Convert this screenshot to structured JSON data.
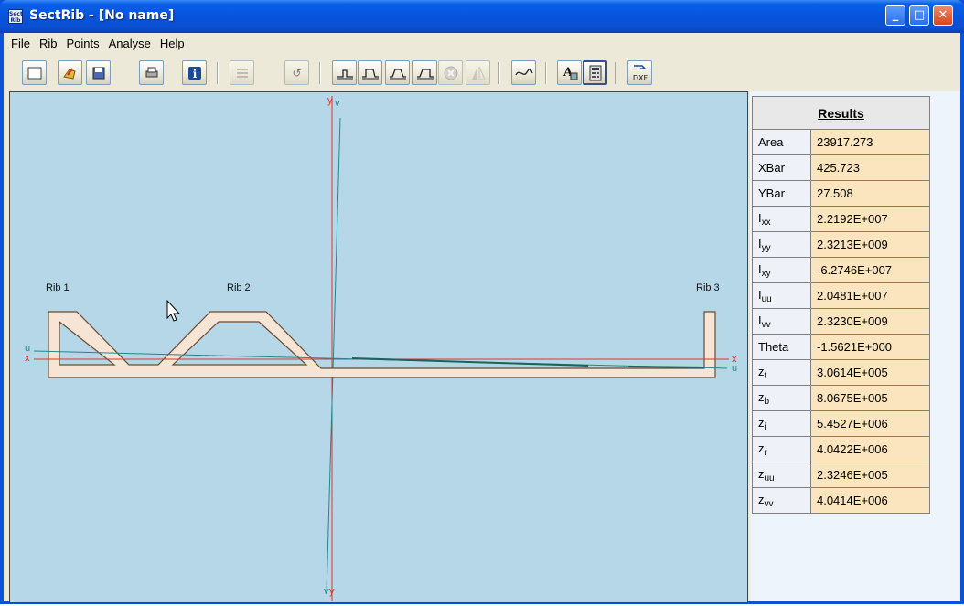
{
  "window": {
    "title": "SectRib - [No name]",
    "app_icon_text": "Sect Rib"
  },
  "menu": [
    "File",
    "Rib",
    "Points",
    "Analyse",
    "Help"
  ],
  "toolbar": {
    "buttons": [
      "new-icon",
      "open-icon",
      "save-icon",
      "print-icon",
      "info-icon",
      "list-icon",
      "undo-icon",
      "rib-shape-1-icon",
      "rib-shape-2-icon",
      "rib-shape-3-icon",
      "rib-shape-4-icon",
      "delete-rib-icon",
      "mirror-icon",
      "curve-icon",
      "text-font-icon",
      "calculator-icon",
      "dxf-export-icon"
    ],
    "dxf_label": "DXF"
  },
  "drawing": {
    "ribs": [
      "Rib 1",
      "Rib 2",
      "Rib 3"
    ],
    "axis_labels": {
      "y": "y",
      "v": "v",
      "x": "x",
      "u": "u"
    }
  },
  "results": {
    "title": "Results",
    "rows": [
      {
        "name": "Area",
        "sub": "",
        "value": "23917.273"
      },
      {
        "name": "XBar",
        "sub": "",
        "value": "425.723"
      },
      {
        "name": "YBar",
        "sub": "",
        "value": "27.508"
      },
      {
        "name": "I",
        "sub": "xx",
        "value": "2.2192E+007"
      },
      {
        "name": "I",
        "sub": "yy",
        "value": "2.3213E+009"
      },
      {
        "name": "I",
        "sub": "xy",
        "value": "-6.2746E+007"
      },
      {
        "name": "I",
        "sub": "uu",
        "value": "2.0481E+007"
      },
      {
        "name": "I",
        "sub": "vv",
        "value": "2.3230E+009"
      },
      {
        "name": "Theta",
        "sub": "",
        "value": "-1.5621E+000"
      },
      {
        "name": "z",
        "sub": "t",
        "value": "3.0614E+005"
      },
      {
        "name": "z",
        "sub": "b",
        "value": "8.0675E+005"
      },
      {
        "name": "z",
        "sub": "i",
        "value": "5.4527E+006"
      },
      {
        "name": "z",
        "sub": "r",
        "value": "4.0422E+006"
      },
      {
        "name": "z",
        "sub": "uu",
        "value": "2.3246E+005"
      },
      {
        "name": "z",
        "sub": "vv",
        "value": "4.0414E+006"
      }
    ]
  },
  "colors": {
    "canvas": "#b6d7e8",
    "section_fill": "#f6e4d4",
    "x_axis": "#e8302c",
    "u_axis": "#1f8a8a",
    "result_value_bg": "#fbe5bf"
  }
}
